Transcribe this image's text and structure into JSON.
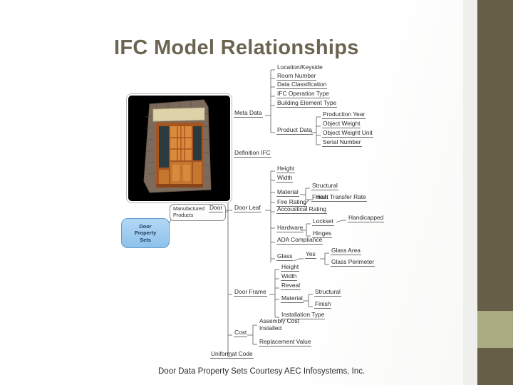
{
  "slide": {
    "title": "IFC Model Relationships",
    "caption": "Door Data Property Sets Courtesy AEC Infosystems, Inc.",
    "accent_dark": "#665E47",
    "accent_light": "#ABAB82",
    "title_color": "#6B6451",
    "background": "#FFFFFF"
  },
  "boxes": {
    "property_sets": "Door\nProperty\nSets",
    "property_sets_color": "#8EC1EA",
    "manufactured": "Manufactured\nProducts",
    "photo_label": "door-in-stone-wall-render"
  },
  "diagram": {
    "type": "mindmap",
    "root": "Door",
    "branches": [
      {
        "label": "Meta Data",
        "children": [
          {
            "label": "Location/Keyside"
          },
          {
            "label": "Room Number"
          },
          {
            "label": "Data Classification"
          },
          {
            "label": "IFC Operation Type"
          },
          {
            "label": "Building Element Type"
          },
          {
            "label": "Product Data",
            "children": [
              {
                "label": "Production Year"
              },
              {
                "label": "Object Weight"
              },
              {
                "label": "Object Weight Unit"
              },
              {
                "label": "Serial Number"
              }
            ]
          }
        ]
      },
      {
        "label": "Definition IFC",
        "children": []
      },
      {
        "label": "Door Leaf",
        "children": [
          {
            "label": "Height"
          },
          {
            "label": "Width"
          },
          {
            "label": "Material",
            "children": [
              {
                "label": "Structural"
              },
              {
                "label": "Finish"
              }
            ]
          },
          {
            "label": "Fire Rating",
            "children": [
              {
                "label": "Heat Transfer Rate"
              }
            ]
          },
          {
            "label": "Accoustical Rating"
          },
          {
            "label": "Hardware",
            "children": [
              {
                "label": "Lockset",
                "children": [
                  {
                    "label": "Handicapped"
                  }
                ]
              },
              {
                "label": "Hinges"
              }
            ]
          },
          {
            "label": "ADA Compliance"
          },
          {
            "label": "Glass",
            "children": [
              {
                "label": "Yes",
                "children": [
                  {
                    "label": "Glass Area"
                  },
                  {
                    "label": "Glass Perimeter"
                  }
                ]
              }
            ]
          }
        ]
      },
      {
        "label": "Door Frame",
        "children": [
          {
            "label": "Height"
          },
          {
            "label": "Width"
          },
          {
            "label": "Reveal"
          },
          {
            "label": "Material",
            "children": [
              {
                "label": "Structural"
              },
              {
                "label": "Finish"
              }
            ]
          },
          {
            "label": "Installation Type"
          }
        ]
      },
      {
        "label": "Cost",
        "children": [
          {
            "label": "Assembly Cost\nInstalled"
          },
          {
            "label": "Replacement Value"
          }
        ]
      },
      {
        "label": "Uniformat Code",
        "children": []
      }
    ]
  },
  "nodes": {
    "door": "Door",
    "meta_data": "Meta Data",
    "location_keyside": "Location/Keyside",
    "room_number": "Room Number",
    "data_classification": "Data Classification",
    "ifc_operation_type": "IFC Operation Type",
    "building_element_type": "Building Element Type",
    "product_data": "Product Data",
    "production_year": "Production Year",
    "object_weight": "Object Weight",
    "object_weight_unit": "Object Weight Unit",
    "serial_number": "Serial Number",
    "definition_ifc": "Definition IFC",
    "door_leaf": "Door Leaf",
    "leaf_height": "Height",
    "leaf_width": "Width",
    "leaf_material": "Material",
    "leaf_structural": "Structural",
    "leaf_finish": "Finish",
    "fire_rating": "Fire Rating",
    "heat_transfer_rate": "Heat Transfer Rate",
    "accoustical_rating": "Accoustical Rating",
    "hardware": "Hardware",
    "lockset": "Lockset",
    "handicapped": "Handicapped",
    "hinges": "Hinges",
    "ada_compliance": "ADA Compliance",
    "glass": "Glass",
    "glass_yes": "Yes",
    "glass_area": "Glass Area",
    "glass_perimeter": "Glass Perimeter",
    "door_frame": "Door Frame",
    "frame_height": "Height",
    "frame_width": "Width",
    "frame_reveal": "Reveal",
    "frame_material": "Material",
    "frame_structural": "Structural",
    "frame_finish": "Finish",
    "installation_type": "Installation Type",
    "cost": "Cost",
    "assembly_cost": "Assembly Cost\nInstalled",
    "replacement_value": "Replacement Value",
    "uniformat_code": "Uniformat Code"
  }
}
